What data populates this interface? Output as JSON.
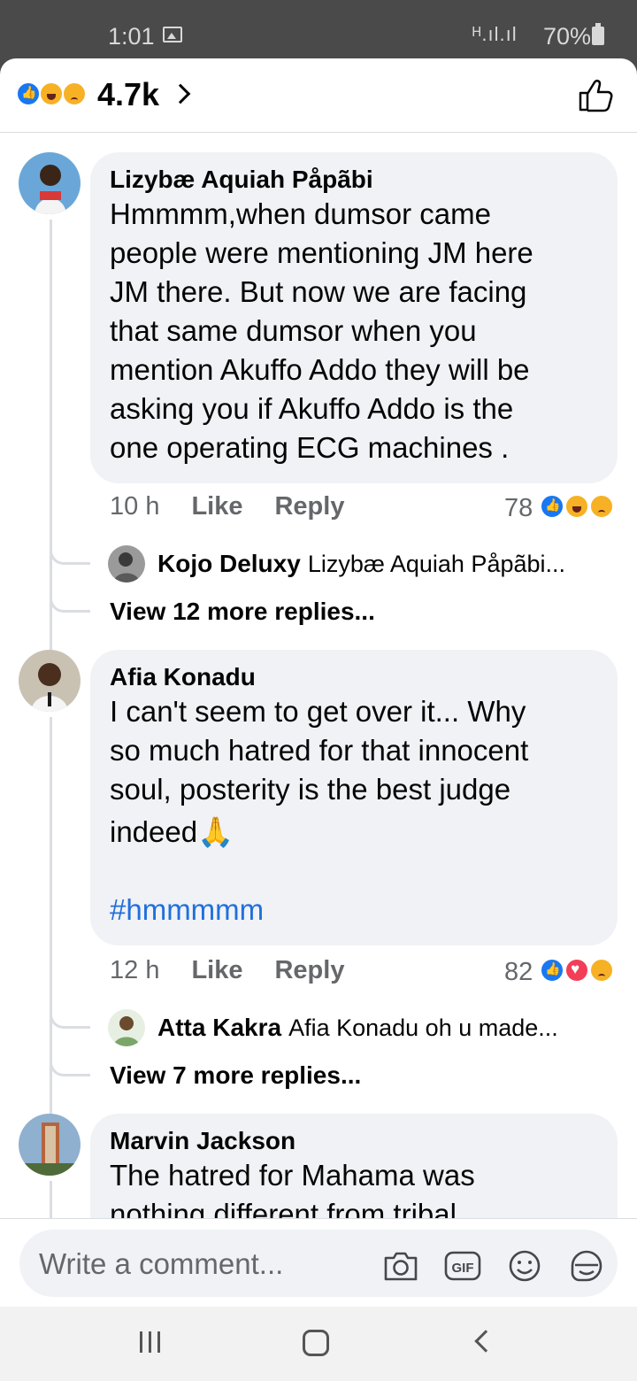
{
  "status_bar": {
    "time": "1:01",
    "signal": "ᴴ.ıl.ıl",
    "battery": "70%"
  },
  "reactions_bar": {
    "count": "4.7k",
    "icons": [
      "like",
      "haha",
      "sad"
    ]
  },
  "comments": [
    {
      "author": "Lizybæ Aquiah Påpãbi",
      "lines": [
        "Hmmmm,when dumsor came",
        "people were mentioning JM here",
        "JM there. But now we are facing",
        "that same dumsor when you",
        "mention Akuffo Addo they will be",
        "asking you if Akuffo Addo is the",
        "one operating ECG machines ."
      ],
      "time": "10 h",
      "like_label": "Like",
      "reply_label": "Reply",
      "reaction_count": "78",
      "reactions": [
        "like",
        "haha",
        "sad"
      ],
      "reply_preview": {
        "author": "Kojo Deluxy",
        "text": "Lizybæ Aquiah Påpãbi..."
      },
      "more_replies": "View 12 more replies..."
    },
    {
      "author": "Afia Konadu",
      "lines": [
        "I can't seem to get over it... Why",
        "so much hatred for that innocent",
        "soul, posterity is the best judge",
        "indeed🙏"
      ],
      "hashtag": "#hmmmmm",
      "time": "12 h",
      "like_label": "Like",
      "reply_label": "Reply",
      "reaction_count": "82",
      "reactions": [
        "like",
        "love",
        "sad"
      ],
      "reply_preview": {
        "author": "Atta Kakra",
        "text": "Afia Konadu oh u made..."
      },
      "more_replies": "View 7 more replies..."
    },
    {
      "author": "Marvin Jackson",
      "lines": [
        "The hatred for Mahama was",
        "nothing different from tribal"
      ]
    }
  ],
  "composer": {
    "placeholder": "Write a comment...",
    "icons": [
      "camera-icon",
      "gif-icon",
      "emoji-icon",
      "sticker-icon"
    ]
  },
  "nav_bar": {
    "icons": [
      "recent-apps-icon",
      "home-icon",
      "back-icon"
    ]
  }
}
